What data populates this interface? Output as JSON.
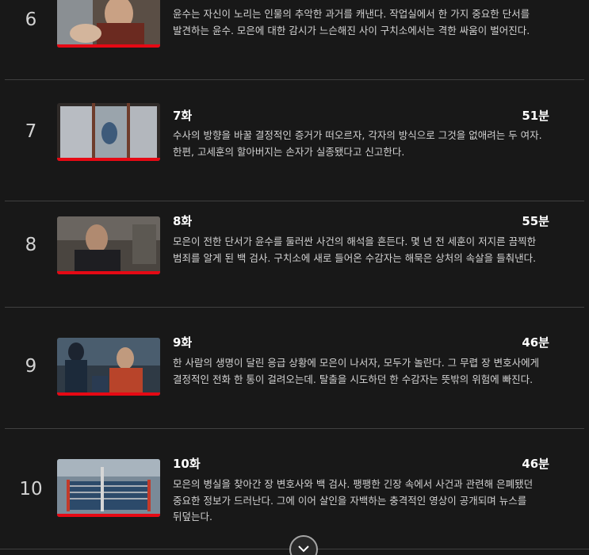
{
  "episodes": [
    {
      "index": "6",
      "title": "",
      "duration": "",
      "synopsis": "윤수는 자신이 노리는 인물의 추악한 과거를 캐낸다. 작업실에서 한 가지 중요한 단서를 발견하는 윤수. 모은에 대한 감시가 느슨해진 사이 구치소에서는 격한 싸움이 벌어진다.",
      "progress": 1.0
    },
    {
      "index": "7",
      "title": "7화",
      "duration": "51분",
      "synopsis": "수사의 방향을 바꿀 결정적인 증거가 떠오르자, 각자의 방식으로 그것을 없애려는 두 여자. 한편, 고세훈의 할아버지는 손자가 실종됐다고 신고한다.",
      "progress": 1.0
    },
    {
      "index": "8",
      "title": "8화",
      "duration": "55분",
      "synopsis": "모은이 전한 단서가 윤수를 둘러싼 사건의 해석을 흔든다. 몇 년 전 세훈이 저지른 끔찍한 범죄를 알게 된 백 검사. 구치소에 새로 들어온 수감자는 해묵은 상처의 속살을 들춰낸다.",
      "progress": 1.0
    },
    {
      "index": "9",
      "title": "9화",
      "duration": "46분",
      "synopsis": "한 사람의 생명이 달린 응급 상황에 모은이 나서자, 모두가 놀란다. 그 무렵 장 변호사에게 결정적인 전화 한 통이 걸려오는데. 탈출을 시도하던 한 수감자는 뜻밖의 위험에 빠진다.",
      "progress": 1.0
    },
    {
      "index": "10",
      "title": "10화",
      "duration": "46분",
      "synopsis": "모은의 병실을 찾아간 장 변호사와 백 검사. 팽팽한 긴장 속에서 사건과 관련해 은폐됐던 중요한 정보가 드러난다. 그에 이어 살인을 자백하는 충격적인 영상이 공개되며 뉴스를 뒤덮는다.",
      "progress": 1.0
    }
  ],
  "colors": {
    "background": "#181818",
    "progress_fill": "#e50914",
    "divider": "#404040"
  },
  "expand_icon": "chevron-down-icon"
}
